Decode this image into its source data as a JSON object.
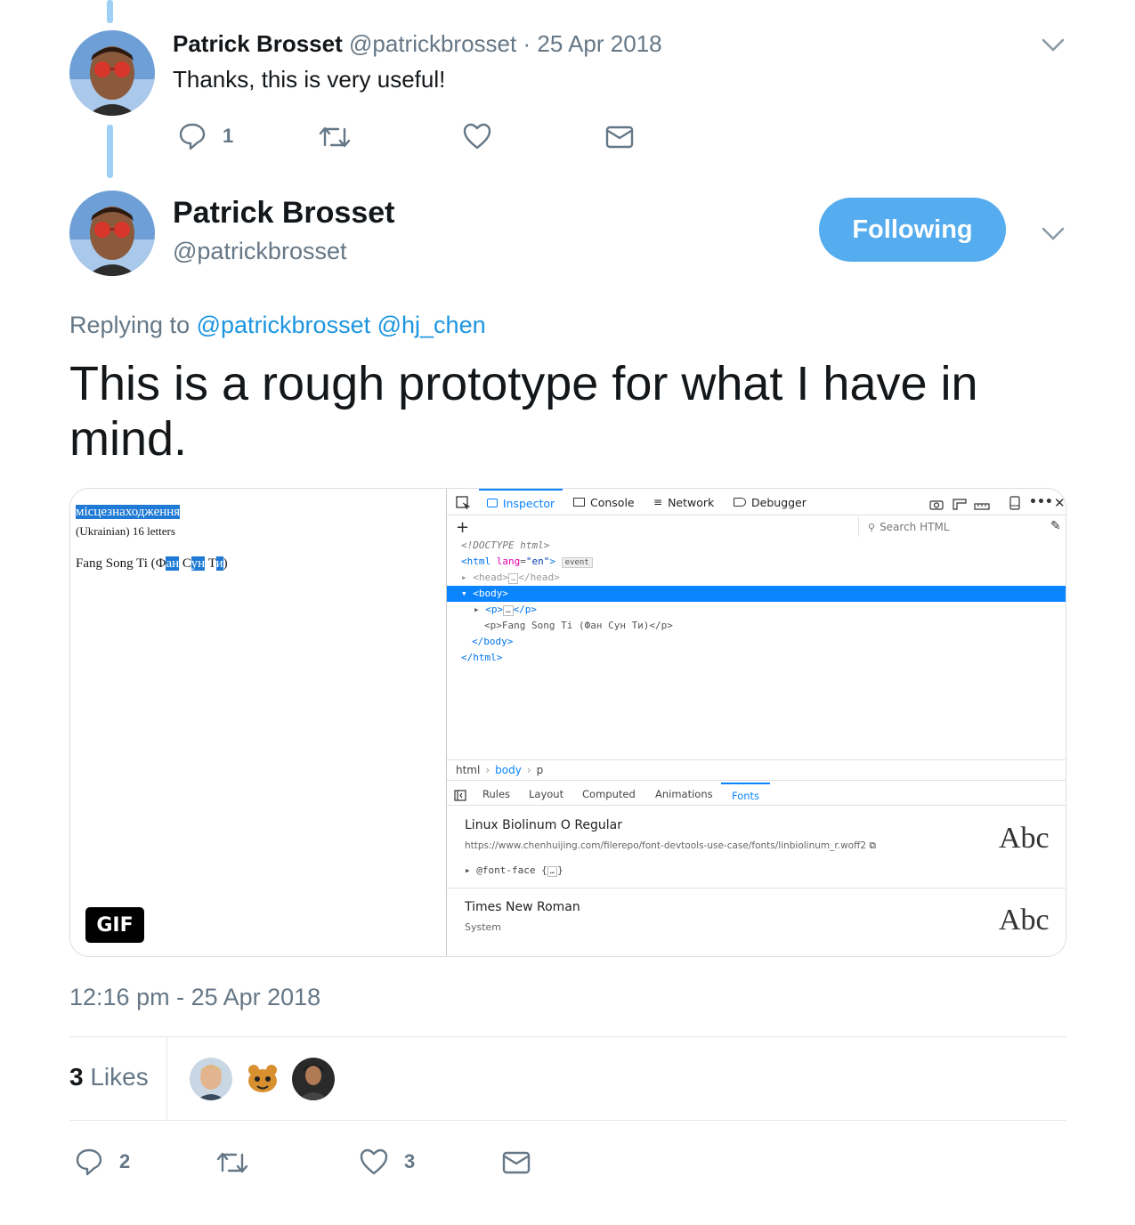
{
  "reply_tweet": {
    "author_name": "Patrick Brosset",
    "author_handle": "@patrickbrosset",
    "separator": "·",
    "date": "25 Apr 2018",
    "text": "Thanks, this is very useful!",
    "reply_count": "1"
  },
  "main_tweet": {
    "author_name": "Patrick Brosset",
    "author_handle": "@patrickbrosset",
    "follow_label": "Following",
    "replying_prefix": "Replying to",
    "replying_to": [
      "@patrickbrosset",
      "@hj_chen"
    ],
    "text": "This is a rough prototype for what I have in mind.",
    "timestamp": "12:16 pm - 25 Apr 2018",
    "likes_count": "3",
    "likes_label": "Likes",
    "reply_count": "2",
    "like_count": "3"
  },
  "media": {
    "gif_label": "GIF",
    "page": {
      "word": "місцезнаходження",
      "word_note": "(Ukrainian) 16 letters",
      "fang_prefix": "Fang Song Ti (Ф",
      "fang_sel1": "ан",
      "fang_mid1": " С",
      "fang_sel2": "ун",
      "fang_mid2": " Т",
      "fang_sel3": "и",
      "fang_suffix": ")"
    },
    "devtools": {
      "tabs": [
        "Inspector",
        "Console",
        "Network",
        "Debugger"
      ],
      "search_placeholder": "Search HTML",
      "code": {
        "doctype": "<!DOCTYPE html>",
        "html_open": "<html",
        "lang_attr": "lang",
        "lang_val": "\"en\"",
        "html_close_bracket": ">",
        "event_badge": "event",
        "head": "<head>",
        "head_close": "</head>",
        "body": "<body>",
        "p_open": "<p>",
        "p_close": "</p>",
        "p2": "<p>Fang Song Ti (Фан Сун Ти)</p>",
        "body_close": "</body>",
        "html_close": "</html>"
      },
      "breadcrumbs": [
        "html",
        "body",
        "p"
      ],
      "panel_tabs": [
        "Rules",
        "Layout",
        "Computed",
        "Animations",
        "Fonts"
      ],
      "fonts": [
        {
          "name": "Linux Biolinum O Regular",
          "url": "https://www.chenhuijing.com/filerepo/font-devtools-use-case/fonts/linbiolinum_r.woff2",
          "rule": "@font-face {",
          "rule_end": "}",
          "sample": "Abc"
        },
        {
          "name": "Times New Roman",
          "source": "System",
          "sample": "Abc"
        }
      ]
    }
  },
  "colors": {
    "accent": "#1b95e0",
    "follow_bg": "#55acee",
    "thread_line": "#9ed0f5",
    "muted": "#657786"
  },
  "icons": [
    "reply-icon",
    "retweet-icon",
    "like-icon",
    "message-icon",
    "chevron-down-icon"
  ]
}
